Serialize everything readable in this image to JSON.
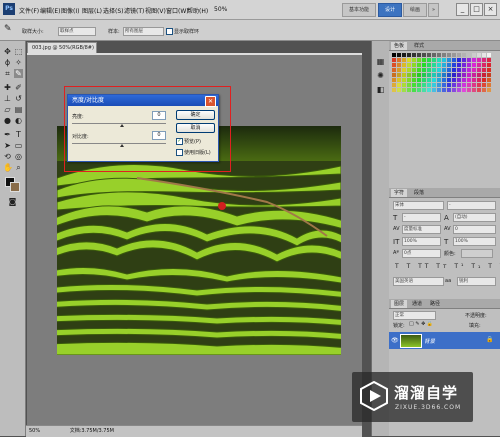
{
  "menubar": {
    "logo": "Ps",
    "items": [
      "文件(F)",
      "编辑(E)",
      "图像(I)",
      "图层(L)",
      "选择(S)",
      "滤镜(T)",
      "视图(V)",
      "窗口(W)",
      "帮助(H)"
    ],
    "zoom": "50%",
    "workspaces": [
      "基本功能",
      "设计",
      "绘画"
    ],
    "active_workspace": "设计",
    "more": "»",
    "window_buttons": [
      "_",
      "□",
      "×"
    ]
  },
  "options": {
    "sample_size_label": "取样大小:",
    "sample_size_value": "取样点",
    "sample_label": "样本:",
    "sample_value": "所有图层",
    "show_ring": "显示取样环"
  },
  "document": {
    "tab_label": "003.jpg @ 50%(RGB/8#)",
    "status_zoom": "50%",
    "status_doc": "文档:3.75M/3.75M"
  },
  "dialog": {
    "title": "亮度/对比度",
    "brightness_label": "亮度:",
    "brightness_value": "0",
    "contrast_label": "对比度:",
    "contrast_value": "0",
    "ok_label": "确定",
    "cancel_label": "取消",
    "preview_label": "预览(P)",
    "preview_checked": true,
    "legacy_label": "使用旧版(L)",
    "legacy_checked": false
  },
  "panels": {
    "swatches_tabs": [
      "色板",
      "样式"
    ],
    "character_tabs": [
      "字符",
      "段落"
    ],
    "character": {
      "font_family": "宋体",
      "font_style": "-",
      "font_size": "-",
      "leading": "(自动)",
      "kerning": "度量标准",
      "tracking": "0",
      "vscale": "100%",
      "hscale": "100%",
      "baseline": "0点",
      "color_label": "颜色:",
      "language": "美国英语",
      "antialias": "锐利"
    },
    "layers_tabs": [
      "图层",
      "通道",
      "路径"
    ],
    "layers": {
      "blend_mode": "正常",
      "opacity_label": "不透明度:",
      "lock_label": "锁定:",
      "fill_label": "填充:",
      "layer_name": "背景"
    }
  },
  "watermark": {
    "title": "溜溜自学",
    "url": "ZIXUE.3D66.COM"
  },
  "colors": {
    "accent": "#3c73c0",
    "highlight_frame": "#e02020",
    "dialog_title": "#1f55c4"
  }
}
